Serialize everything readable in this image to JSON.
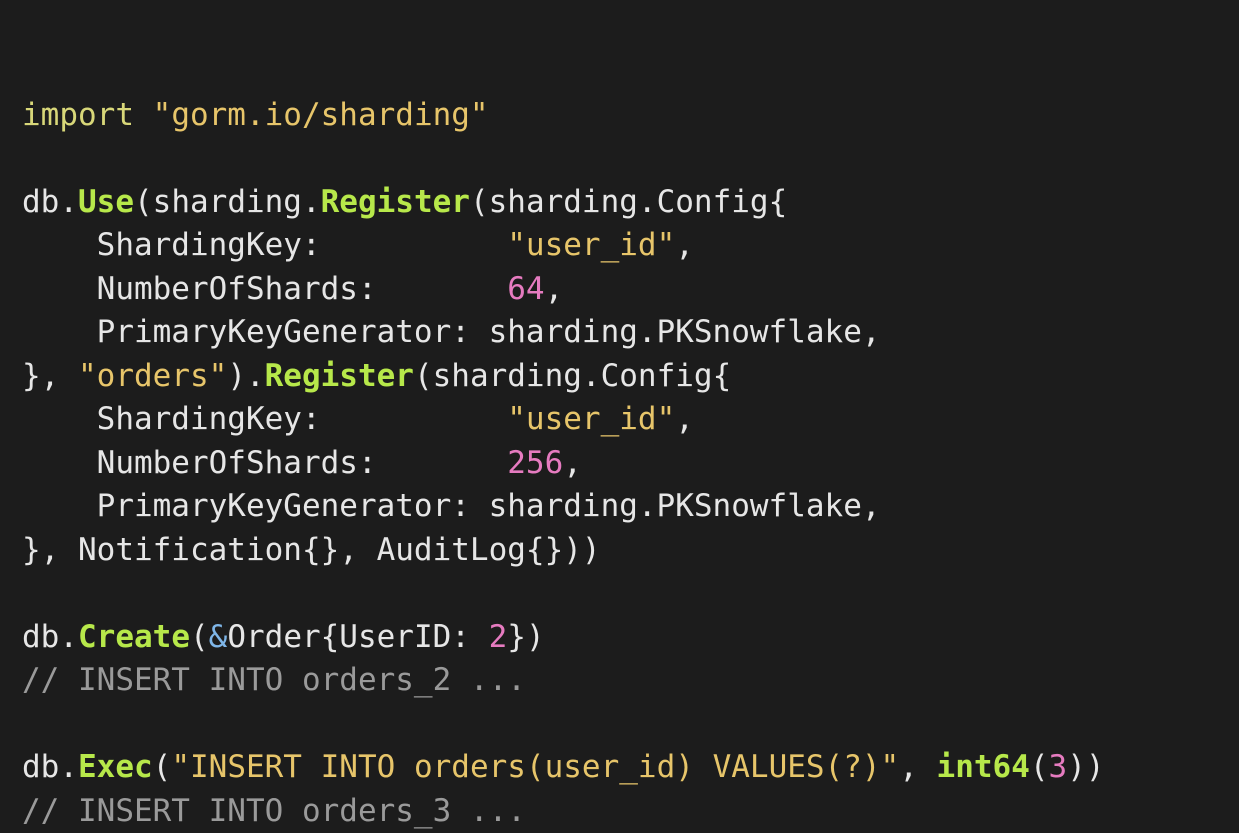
{
  "code": {
    "lines": [
      [],
      [
        {
          "t": "import",
          "c": "kw"
        },
        {
          "t": " ",
          "c": "pl"
        },
        {
          "t": "\"gorm.io/sharding\"",
          "c": "str"
        }
      ],
      [],
      [
        {
          "t": "db.",
          "c": "pl"
        },
        {
          "t": "Use",
          "c": "fn"
        },
        {
          "t": "(sharding.",
          "c": "pl"
        },
        {
          "t": "Register",
          "c": "fn"
        },
        {
          "t": "(sharding.Config{",
          "c": "pl"
        }
      ],
      [
        {
          "t": "    ShardingKey:          ",
          "c": "pl"
        },
        {
          "t": "\"user_id\"",
          "c": "str"
        },
        {
          "t": ",",
          "c": "pl"
        }
      ],
      [
        {
          "t": "    NumberOfShards:       ",
          "c": "pl"
        },
        {
          "t": "64",
          "c": "num"
        },
        {
          "t": ",",
          "c": "pl"
        }
      ],
      [
        {
          "t": "    PrimaryKeyGenerator: sharding.PKSnowflake,",
          "c": "pl"
        }
      ],
      [
        {
          "t": "}, ",
          "c": "pl"
        },
        {
          "t": "\"orders\"",
          "c": "str"
        },
        {
          "t": ").",
          "c": "pl"
        },
        {
          "t": "Register",
          "c": "fn"
        },
        {
          "t": "(sharding.Config{",
          "c": "pl"
        }
      ],
      [
        {
          "t": "    ShardingKey:          ",
          "c": "pl"
        },
        {
          "t": "\"user_id\"",
          "c": "str"
        },
        {
          "t": ",",
          "c": "pl"
        }
      ],
      [
        {
          "t": "    NumberOfShards:       ",
          "c": "pl"
        },
        {
          "t": "256",
          "c": "num"
        },
        {
          "t": ",",
          "c": "pl"
        }
      ],
      [
        {
          "t": "    PrimaryKeyGenerator: sharding.PKSnowflake,",
          "c": "pl"
        }
      ],
      [
        {
          "t": "}, Notification{}, AuditLog{}))",
          "c": "pl"
        }
      ],
      [],
      [
        {
          "t": "db.",
          "c": "pl"
        },
        {
          "t": "Create",
          "c": "fn"
        },
        {
          "t": "(",
          "c": "pl"
        },
        {
          "t": "&",
          "c": "op"
        },
        {
          "t": "Order{UserID: ",
          "c": "pl"
        },
        {
          "t": "2",
          "c": "num"
        },
        {
          "t": "})",
          "c": "pl"
        }
      ],
      [
        {
          "t": "// INSERT INTO orders_2 ...",
          "c": "com"
        }
      ],
      [],
      [
        {
          "t": "db.",
          "c": "pl"
        },
        {
          "t": "Exec",
          "c": "fn"
        },
        {
          "t": "(",
          "c": "pl"
        },
        {
          "t": "\"INSERT INTO orders(user_id) VALUES(?)\"",
          "c": "str"
        },
        {
          "t": ", ",
          "c": "pl"
        },
        {
          "t": "int64",
          "c": "fn"
        },
        {
          "t": "(",
          "c": "pl"
        },
        {
          "t": "3",
          "c": "num"
        },
        {
          "t": "))",
          "c": "pl"
        }
      ],
      [
        {
          "t": "// INSERT INTO orders_3 ...",
          "c": "com"
        }
      ]
    ]
  },
  "colors": {
    "background": "#1c1c1c",
    "keyword": "#d8d779",
    "string": "#e7c56a",
    "function": "#b7e84a",
    "number": "#e67bc0",
    "operator": "#7fb6e8",
    "comment": "#9a9a9a",
    "plain": "#e6e6e6"
  }
}
